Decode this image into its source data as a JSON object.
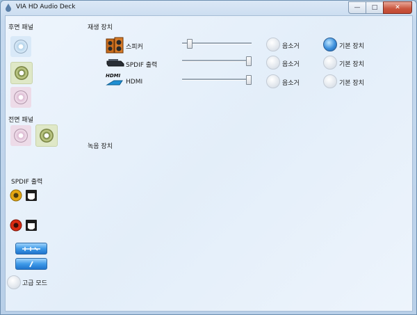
{
  "window": {
    "title": "VIA HD Audio Deck",
    "caption_minimize": "—",
    "caption_maximize": "□",
    "caption_close": "✕"
  },
  "left_panel": {
    "rear_panel_label": "후면 패널",
    "front_panel_label": "전면 패널",
    "spdif_label": "SPDIF 출력",
    "advanced_mode_label": "고급 모드"
  },
  "playback": {
    "section_label": "재생 장치",
    "devices": [
      {
        "name": "스피커",
        "icon": "speaker-icon",
        "volume_percent": 8,
        "mute_label": "음소거",
        "mute_on": false,
        "default_label": "기본 장치",
        "is_default": true
      },
      {
        "name": "SPDIF 출력",
        "icon": "spdif-device-icon",
        "volume_percent": 100,
        "mute_label": "음소거",
        "mute_on": false,
        "default_label": "기본 장치",
        "is_default": false
      },
      {
        "name": "HDMI",
        "icon": "hdmi-icon",
        "volume_percent": 100,
        "mute_label": "음소거",
        "mute_on": false,
        "default_label": "기본 장치",
        "is_default": false
      }
    ]
  },
  "recording": {
    "section_label": "녹음 장치"
  },
  "hdmi_logo_text": "HDMI",
  "colors": {
    "rear_blue": "#d9e9f8",
    "rear_green": "#dfe8c7",
    "rear_pink": "#eddbe8",
    "default_radio_on": "#3b8fdc",
    "button_blue": "#3f9ae8"
  }
}
